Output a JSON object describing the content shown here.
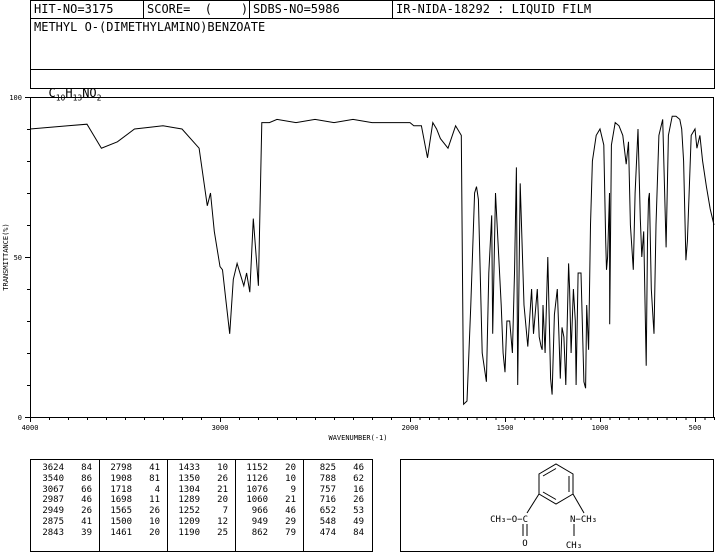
{
  "header": {
    "hit_no": "HIT-NO=3175",
    "score": "SCORE=  (    )",
    "sdbs_no": "SDBS-NO=5986",
    "source": "IR-NIDA-18292 : LIQUID FILM",
    "compound": "METHYL O-(DIMETHYLAMINO)BENZOATE",
    "formula_parts": [
      "C",
      "10",
      "H",
      "13",
      "NO",
      "2"
    ]
  },
  "chart_data": {
    "type": "line",
    "xlabel": "WAVENUMBER(-1)",
    "ylabel": "TRANSMITTANCE(%)",
    "xlim": [
      4000,
      400
    ],
    "ylim": [
      0,
      100
    ],
    "x_ticks": [
      "4000",
      "3000",
      "2000",
      "1500",
      "1000",
      "500"
    ],
    "y_ticks": [
      "100",
      "50",
      "0"
    ],
    "series": [
      {
        "x": [
          4000,
          3900,
          3800,
          3700,
          3624,
          3540,
          3450,
          3300,
          3200,
          3110,
          3067,
          3050,
          3030,
          3000,
          2987,
          2970,
          2949,
          2930,
          2910,
          2890,
          2875,
          2860,
          2843,
          2825,
          2798,
          2780,
          2760,
          2740,
          2700,
          2600,
          2500,
          2400,
          2300,
          2200,
          2100,
          2000,
          1980,
          1940,
          1908,
          1880,
          1860,
          1840,
          1800,
          1760,
          1730,
          1718,
          1700,
          1680,
          1660,
          1650,
          1640,
          1620,
          1598,
          1585,
          1570,
          1565,
          1550,
          1520,
          1510,
          1500,
          1490,
          1475,
          1461,
          1450,
          1440,
          1433,
          1420,
          1400,
          1380,
          1360,
          1350,
          1330,
          1320,
          1310,
          1304,
          1300,
          1289,
          1275,
          1260,
          1252,
          1240,
          1225,
          1216,
          1209,
          1200,
          1190,
          1180,
          1165,
          1160,
          1152,
          1140,
          1130,
          1126,
          1115,
          1100,
          1085,
          1076,
          1070,
          1060,
          1050,
          1040,
          1020,
          1000,
          980,
          970,
          966,
          960,
          950,
          949,
          940,
          920,
          900,
          880,
          862,
          850,
          840,
          825,
          815,
          800,
          788,
          780,
          770,
          757,
          750,
          745,
          740,
          730,
          720,
          716,
          705,
          690,
          670,
          652,
          640,
          620,
          600,
          580,
          570,
          560,
          548,
          540,
          520,
          500,
          490,
          474,
          460,
          440,
          420,
          400
        ],
        "y": [
          90,
          90.5,
          91,
          91.5,
          84,
          86,
          90,
          91,
          90,
          84,
          66,
          70,
          58,
          47,
          46,
          37,
          26,
          43,
          48,
          44,
          41,
          45,
          39,
          62,
          41,
          92,
          92,
          92,
          93,
          92,
          93,
          92,
          93,
          92,
          92,
          92,
          91,
          91,
          81,
          92,
          90,
          87,
          84,
          91,
          88,
          4,
          5,
          35,
          70,
          72,
          68,
          20,
          11,
          45,
          63,
          26,
          70,
          35,
          20,
          14,
          30,
          30,
          20,
          45,
          78,
          10,
          73,
          35,
          22,
          40,
          26,
          40,
          25,
          22,
          21,
          35,
          20,
          50,
          12,
          7,
          32,
          40,
          25,
          12,
          28,
          25,
          10,
          48,
          40,
          20,
          40,
          30,
          10,
          45,
          45,
          11,
          9,
          35,
          21,
          60,
          80,
          88,
          90,
          85,
          55,
          46,
          50,
          70,
          29,
          85,
          92,
          91,
          88,
          79,
          86,
          60,
          46,
          70,
          90,
          62,
          50,
          58,
          16,
          55,
          68,
          70,
          40,
          30,
          26,
          60,
          88,
          93,
          53,
          88,
          94,
          94,
          93,
          90,
          80,
          49,
          55,
          88,
          90,
          84,
          88,
          80,
          72,
          65,
          60
        ]
      }
    ],
    "peak_table": {
      "columns": [
        [
          [
            "3624",
            "84"
          ],
          [
            "3540",
            "86"
          ],
          [
            "3067",
            "66"
          ],
          [
            "2987",
            "46"
          ],
          [
            "2949",
            "26"
          ],
          [
            "2875",
            "41"
          ],
          [
            "2843",
            "39"
          ]
        ],
        [
          [
            "2798",
            "41"
          ],
          [
            "1908",
            "81"
          ],
          [
            "1718",
            "4"
          ],
          [
            "1698",
            "11"
          ],
          [
            "1565",
            "26"
          ],
          [
            "1500",
            "10"
          ],
          [
            "1461",
            "20"
          ]
        ],
        [
          [
            "1433",
            "10"
          ],
          [
            "1350",
            "26"
          ],
          [
            "1304",
            "21"
          ],
          [
            "1289",
            "20"
          ],
          [
            "1252",
            "7"
          ],
          [
            "1209",
            "12"
          ],
          [
            "1190",
            "25"
          ]
        ],
        [
          [
            "1152",
            "20"
          ],
          [
            "1126",
            "10"
          ],
          [
            "1076",
            "9"
          ],
          [
            "1060",
            "21"
          ],
          [
            "966",
            "46"
          ],
          [
            "949",
            "29"
          ],
          [
            "862",
            "79"
          ]
        ],
        [
          [
            "825",
            "46"
          ],
          [
            "788",
            "62"
          ],
          [
            "757",
            "16"
          ],
          [
            "716",
            "26"
          ],
          [
            "652",
            "53"
          ],
          [
            "548",
            "49"
          ],
          [
            "474",
            "84"
          ]
        ]
      ]
    }
  },
  "structure": {
    "ester_left": "CH₃−O−C",
    "carbonyl_o": "O",
    "amine_right": "N−CH₃",
    "amine_down": "CH₃"
  }
}
